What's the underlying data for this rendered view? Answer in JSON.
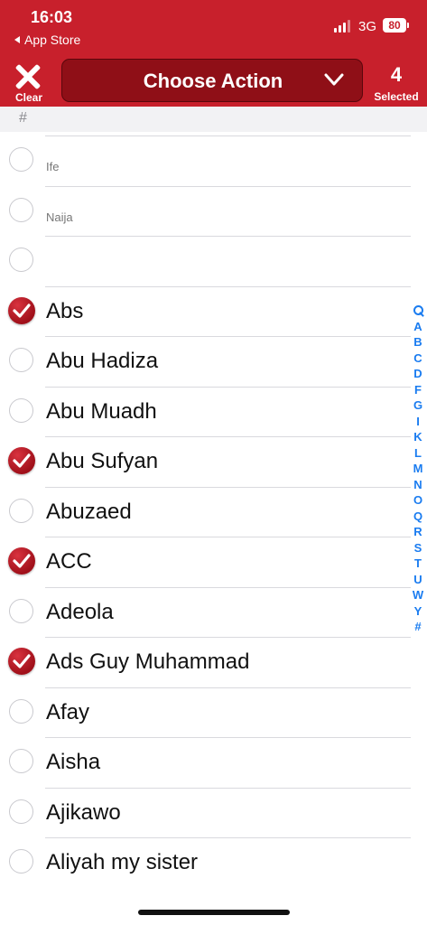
{
  "status_bar": {
    "time": "16:03",
    "back_label": "App Store",
    "network": "3G",
    "battery": "80"
  },
  "toolbar": {
    "clear_label": "Clear",
    "action_label": "Choose Action",
    "selected_count": "4",
    "selected_label": "Selected"
  },
  "section": {
    "label": "#"
  },
  "contacts": [
    {
      "name": "Ife",
      "small": true,
      "checked": false
    },
    {
      "name": "Naija",
      "small": true,
      "checked": false
    },
    {
      "name": "",
      "small": true,
      "checked": false
    },
    {
      "name": "Abs",
      "small": false,
      "checked": true
    },
    {
      "name": "Abu Hadiza",
      "small": false,
      "checked": false
    },
    {
      "name": "Abu Muadh",
      "small": false,
      "checked": false
    },
    {
      "name": "Abu Sufyan",
      "small": false,
      "checked": true
    },
    {
      "name": "Abuzaed",
      "small": false,
      "checked": false
    },
    {
      "name": "ACC",
      "small": false,
      "checked": true
    },
    {
      "name": "Adeola",
      "small": false,
      "checked": false
    },
    {
      "name": "Ads Guy Muhammad",
      "small": false,
      "checked": true
    },
    {
      "name": "Afay",
      "small": false,
      "checked": false
    },
    {
      "name": "Aisha",
      "small": false,
      "checked": false
    },
    {
      "name": "Ajikawo",
      "small": false,
      "checked": false
    },
    {
      "name": "Aliyah my sister",
      "small": false,
      "checked": false
    }
  ],
  "index_letters": [
    "A",
    "B",
    "C",
    "D",
    "F",
    "G",
    "I",
    "K",
    "L",
    "M",
    "N",
    "O",
    "Q",
    "R",
    "S",
    "T",
    "U",
    "W",
    "Y",
    "#"
  ],
  "colors": {
    "header": "#c8202c",
    "action_button": "#8f0f17",
    "index": "#1a7cf0"
  }
}
